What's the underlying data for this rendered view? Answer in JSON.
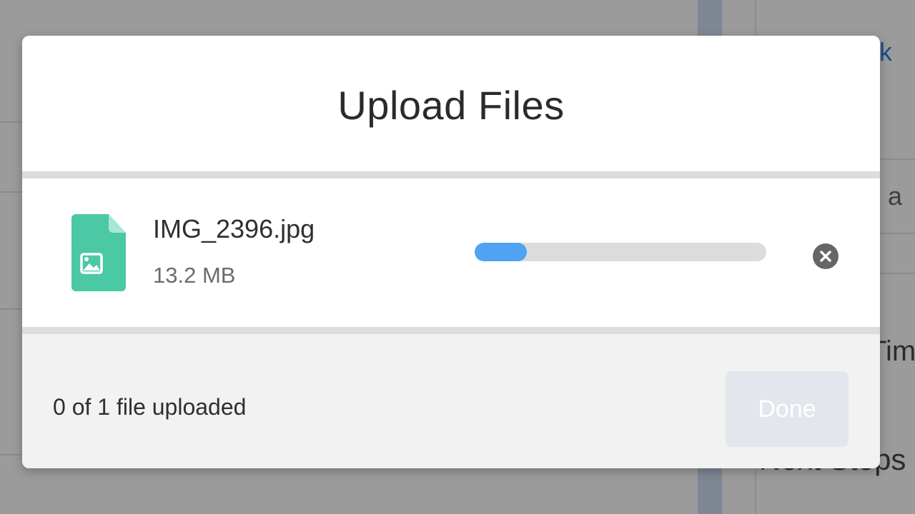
{
  "background": {
    "link_fragment": "sk",
    "text_fragment": "e a",
    "heading_fragment": "Tim",
    "heading_fragment_2": "Next Steps"
  },
  "modal": {
    "title": "Upload Files",
    "files": [
      {
        "name": "IMG_2396.jpg",
        "size": "13.2 MB",
        "icon": "image-file-icon",
        "progress": 0.18
      }
    ],
    "status": "0 of 1 file uploaded",
    "done_label": "Done",
    "done_enabled": false
  },
  "colors": {
    "file_icon": "#4bc8a4",
    "progress_fill": "#4fa3f2",
    "progress_track": "#dcdcdc",
    "done_disabled_bg": "#e3e6ed",
    "overlay": "#9b9b9b"
  }
}
